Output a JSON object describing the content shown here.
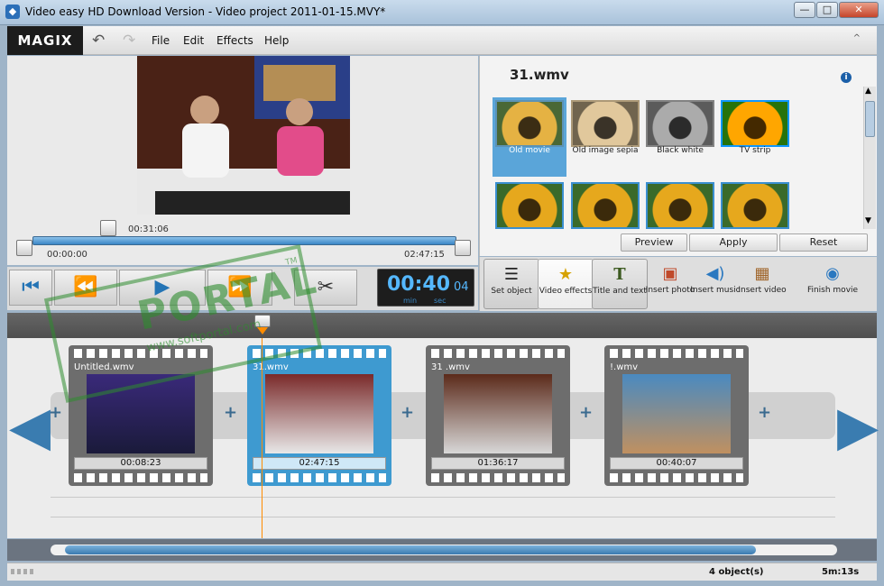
{
  "window": {
    "title": "Video easy HD Download Version - Video project 2011-01-15.MVY*",
    "minimize": "—",
    "maximize": "□",
    "close": "✕"
  },
  "menu": {
    "logo": "MAGIX",
    "items": [
      "File",
      "Edit",
      "Effects",
      "Help"
    ],
    "undo": "↶",
    "redo": "↷",
    "collapse": "^"
  },
  "preview": {
    "handle_time": "00:31:06",
    "start_time": "00:00:00",
    "end_time": "02:47:15"
  },
  "transport": {
    "to_start": "⏮",
    "rewind": "⏪",
    "play": "▶",
    "forward": "⏩",
    "cut": "✂"
  },
  "timecode": {
    "main": "00:40",
    "frames": "04",
    "min": "min",
    "sec": "sec"
  },
  "effects": {
    "clip_name": "31.wmv",
    "info": "i",
    "thumbnails": [
      {
        "label": "Old movie"
      },
      {
        "label": "Old image sepia"
      },
      {
        "label": "Black white"
      },
      {
        "label": "TV strip"
      },
      {
        "label": ""
      },
      {
        "label": ""
      },
      {
        "label": ""
      },
      {
        "label": ""
      }
    ],
    "buttons": {
      "preview": "Preview",
      "apply": "Apply",
      "reset": "Reset"
    }
  },
  "tools": [
    {
      "label": "Set object",
      "icon": "sliders-icon"
    },
    {
      "label": "Video effects",
      "icon": "magic-wand-icon"
    },
    {
      "label": "Title and text",
      "icon": "title-t-icon"
    },
    {
      "label": "Insert photo",
      "icon": "insert-photo-icon"
    },
    {
      "label": "Insert music",
      "icon": "insert-music-icon"
    },
    {
      "label": "Insert video",
      "icon": "insert-video-icon"
    },
    {
      "label": "Finish movie",
      "icon": "finish-movie-icon"
    }
  ],
  "storyboard": {
    "clips": [
      {
        "name": "Untitled.wmv",
        "duration": "00:08:23"
      },
      {
        "name": "31.wmv",
        "duration": "02:47:15"
      },
      {
        "name": "31 .wmv",
        "duration": "01:36:17"
      },
      {
        "name": "!.wmv",
        "duration": "00:40:07"
      }
    ],
    "plus": "+"
  },
  "watermark": {
    "text": "PORTAL",
    "tm": "TM",
    "sub": "www.softportal.com"
  },
  "status": {
    "count": "4 object(s)",
    "duration": "5m:13s"
  }
}
